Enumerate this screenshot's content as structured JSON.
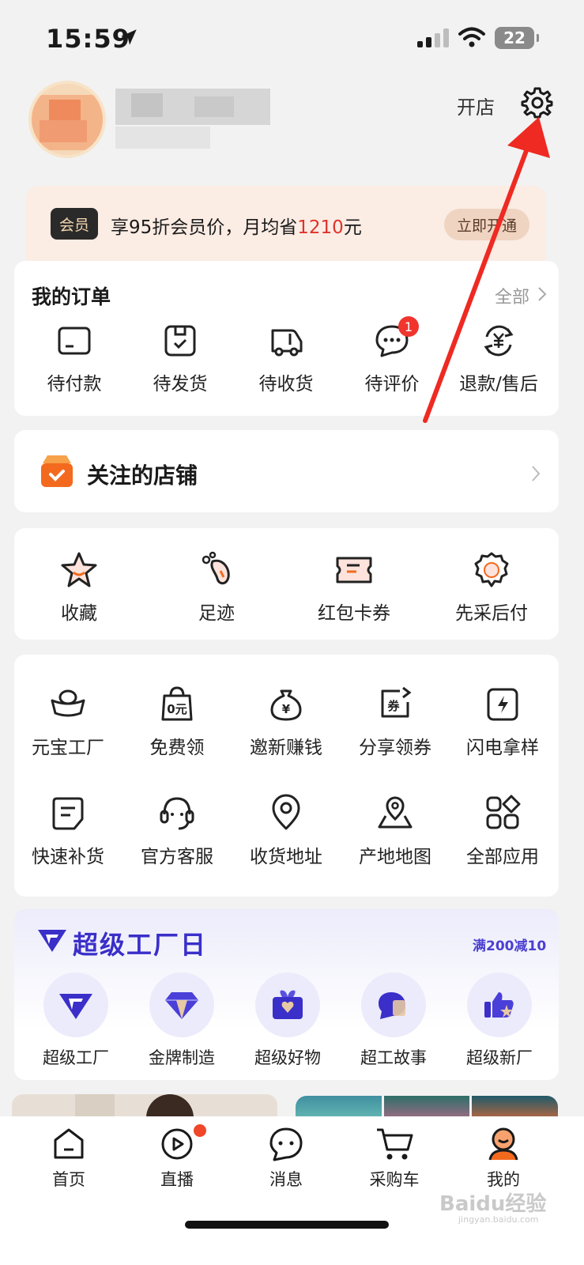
{
  "status_bar": {
    "time": "15:59",
    "battery": "22"
  },
  "header": {
    "open_shop": "开店"
  },
  "member": {
    "badge": "会员",
    "text_pre": "享95折会员价，月均省",
    "amount": "1210",
    "text_post": "元",
    "button": "立即开通"
  },
  "orders": {
    "title": "我的订单",
    "all": "全部",
    "items": [
      {
        "label": "待付款",
        "icon": "card-icon"
      },
      {
        "label": "待发货",
        "icon": "package-icon"
      },
      {
        "label": "待收货",
        "icon": "truck-icon"
      },
      {
        "label": "待评价",
        "icon": "chat-icon",
        "badge": "1"
      },
      {
        "label": "退款/售后",
        "icon": "refund-icon"
      }
    ]
  },
  "followed_shops": {
    "title": "关注的店铺"
  },
  "tools": [
    {
      "label": "收藏",
      "icon": "star-icon"
    },
    {
      "label": "足迹",
      "icon": "footprint-icon"
    },
    {
      "label": "红包卡券",
      "icon": "ticket-icon"
    },
    {
      "label": "先采后付",
      "icon": "pay-later-icon"
    }
  ],
  "apps": [
    {
      "label": "元宝工厂",
      "icon": "ingot-icon"
    },
    {
      "label": "免费领",
      "icon": "free-bag-icon"
    },
    {
      "label": "邀新赚钱",
      "icon": "money-bag-icon"
    },
    {
      "label": "分享领券",
      "icon": "share-coupon-icon"
    },
    {
      "label": "闪电拿样",
      "icon": "lightning-icon"
    },
    {
      "label": "快速补货",
      "icon": "restock-icon"
    },
    {
      "label": "官方客服",
      "icon": "headset-icon"
    },
    {
      "label": "收货地址",
      "icon": "location-icon"
    },
    {
      "label": "产地地图",
      "icon": "map-icon"
    },
    {
      "label": "全部应用",
      "icon": "apps-icon"
    }
  ],
  "factory_day": {
    "title": "超级工厂日",
    "promo": "满200减10",
    "items": [
      {
        "label": "超级工厂"
      },
      {
        "label": "金牌制造"
      },
      {
        "label": "超级好物"
      },
      {
        "label": "超工故事"
      },
      {
        "label": "超级新厂"
      }
    ]
  },
  "tabbar": [
    {
      "label": "首页",
      "icon": "home-icon"
    },
    {
      "label": "直播",
      "icon": "live-icon"
    },
    {
      "label": "消息",
      "icon": "message-icon"
    },
    {
      "label": "采购车",
      "icon": "cart-icon"
    },
    {
      "label": "我的",
      "icon": "profile-icon"
    }
  ],
  "watermark": {
    "text": "Baidu经验",
    "sub": "jingyan.baidu.com"
  },
  "colors": {
    "accent_red": "#e0322b",
    "brand_orange": "#f36a1f",
    "factory_blue": "#3a2fc9"
  }
}
